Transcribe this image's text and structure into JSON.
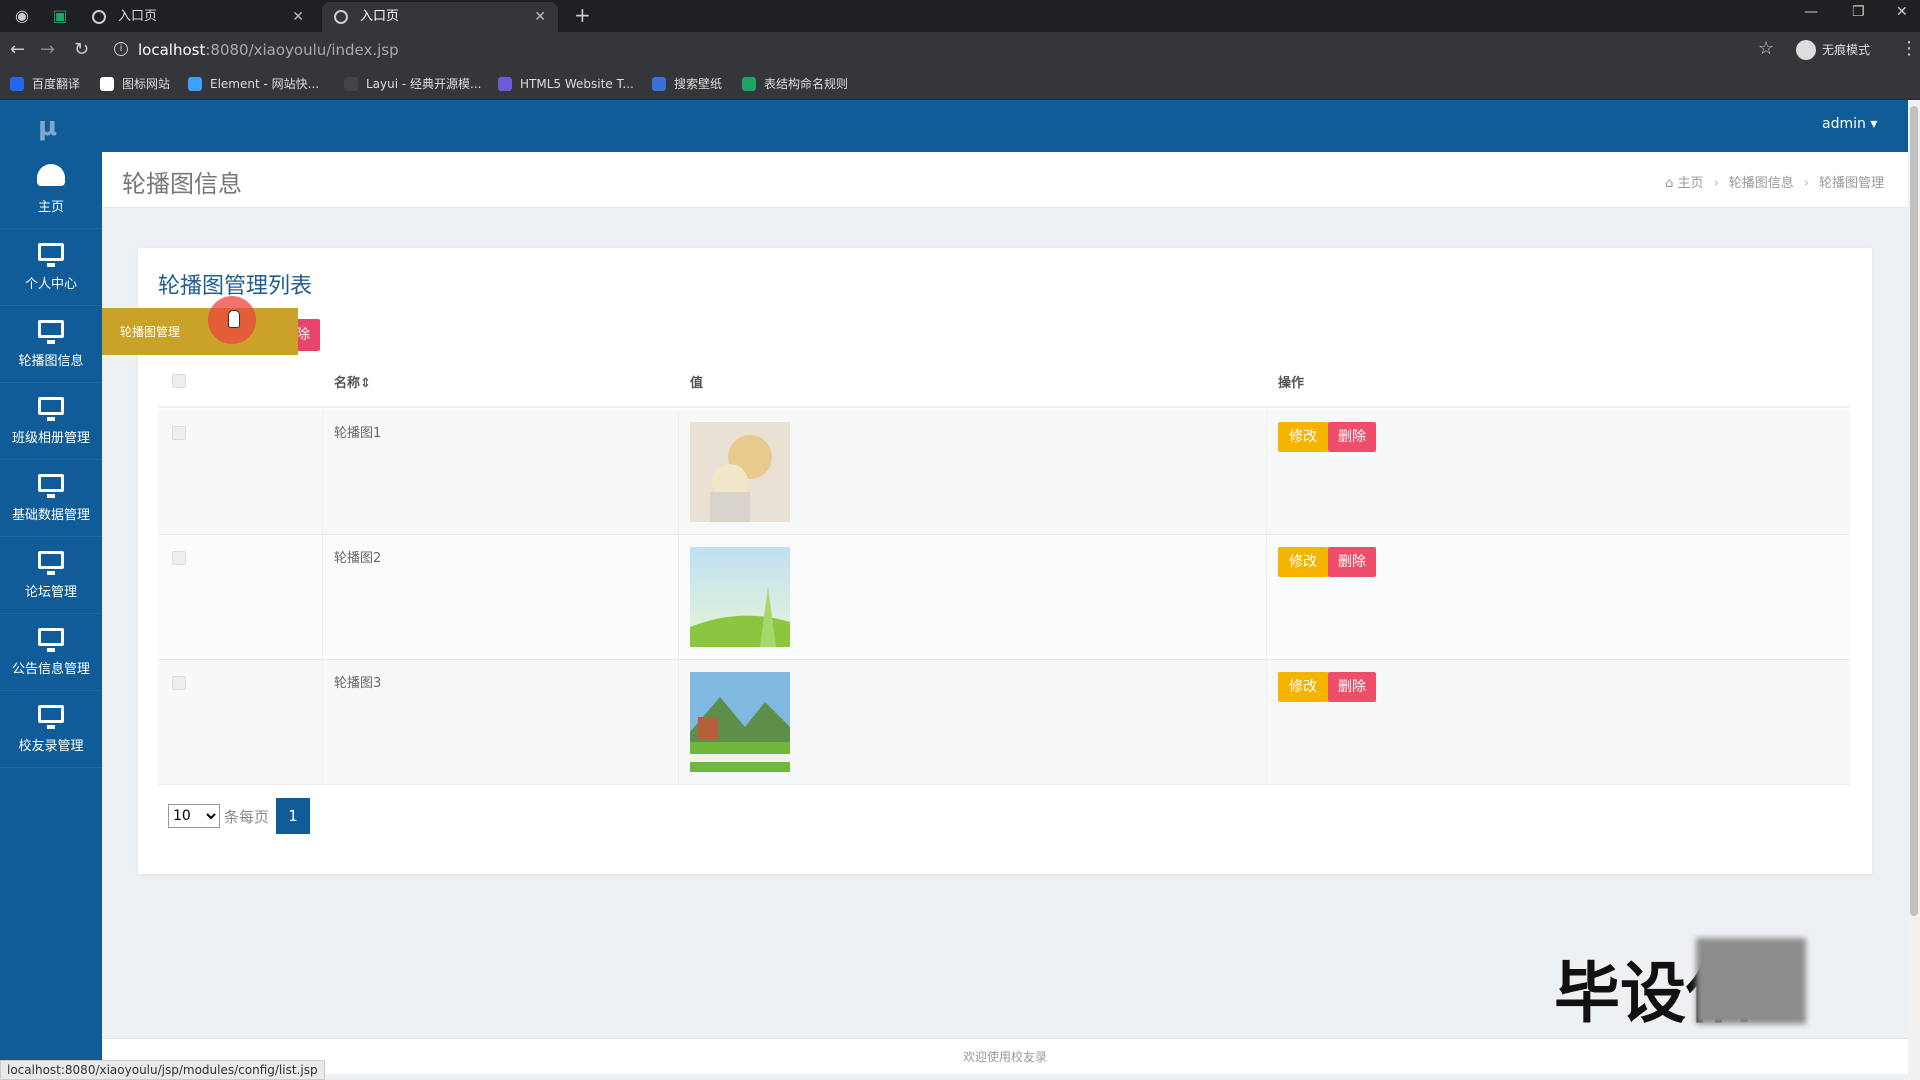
{
  "browser": {
    "tabs": [
      {
        "label": "入口页",
        "active": false
      },
      {
        "label": "入口页",
        "active": true
      }
    ],
    "url_host": "localhost",
    "url_path": ":8080/xiaoyoulu/index.jsp",
    "incognito_label": "无痕模式",
    "bookmarks": [
      {
        "label": "百度翻译",
        "color": "#2468f2"
      },
      {
        "label": "图标网站",
        "color": "#ffffff"
      },
      {
        "label": "Element - 网站快...",
        "color": "#409eff"
      },
      {
        "label": "Layui - 经典开源模...",
        "color": "#222222"
      },
      {
        "label": "HTML5 Website T...",
        "color": "#6b5bd6"
      },
      {
        "label": "搜索壁纸",
        "color": "#3b6fd8"
      },
      {
        "label": "表结构命名规则",
        "color": "#1fa463"
      }
    ],
    "status_url": "localhost:8080/xiaoyoulu/jsp/modules/config/list.jsp"
  },
  "app": {
    "logo": "μ",
    "user": "admin ▾",
    "colors": {
      "primary": "#0f5c98",
      "warning": "#f4b400",
      "danger": "#ef4e6b",
      "submenu": "#c9a227"
    }
  },
  "sidebar": {
    "items": [
      {
        "label": "主页",
        "icon": "dashboard-icon"
      },
      {
        "label": "个人中心",
        "icon": "monitor-icon"
      },
      {
        "label": "轮播图信息",
        "icon": "monitor-icon"
      },
      {
        "label": "班级相册管理",
        "icon": "monitor-icon"
      },
      {
        "label": "基础数据管理",
        "icon": "monitor-icon"
      },
      {
        "label": "论坛管理",
        "icon": "monitor-icon"
      },
      {
        "label": "公告信息管理",
        "icon": "monitor-icon"
      },
      {
        "label": "校友录管理",
        "icon": "monitor-icon"
      }
    ],
    "submenu_label": "轮播图管理"
  },
  "page": {
    "title": "轮播图信息",
    "breadcrumb": [
      "主页",
      "轮播图信息",
      "轮播图管理"
    ]
  },
  "card": {
    "title": "轮播图管理列表",
    "delete_partial": "除"
  },
  "table": {
    "headers": [
      "名称⇕",
      "值",
      "操作"
    ],
    "rows": [
      {
        "name": "轮播图1",
        "edit": "修改",
        "delete": "删除"
      },
      {
        "name": "轮播图2",
        "edit": "修改",
        "delete": "删除"
      },
      {
        "name": "轮播图3",
        "edit": "修改",
        "delete": "删除"
      }
    ]
  },
  "pager": {
    "page_size": "10",
    "per_page_label": "条每页",
    "current_page": "1"
  },
  "footer": {
    "text": "欢迎使用校友录"
  },
  "watermark": {
    "text": "毕设佑"
  }
}
